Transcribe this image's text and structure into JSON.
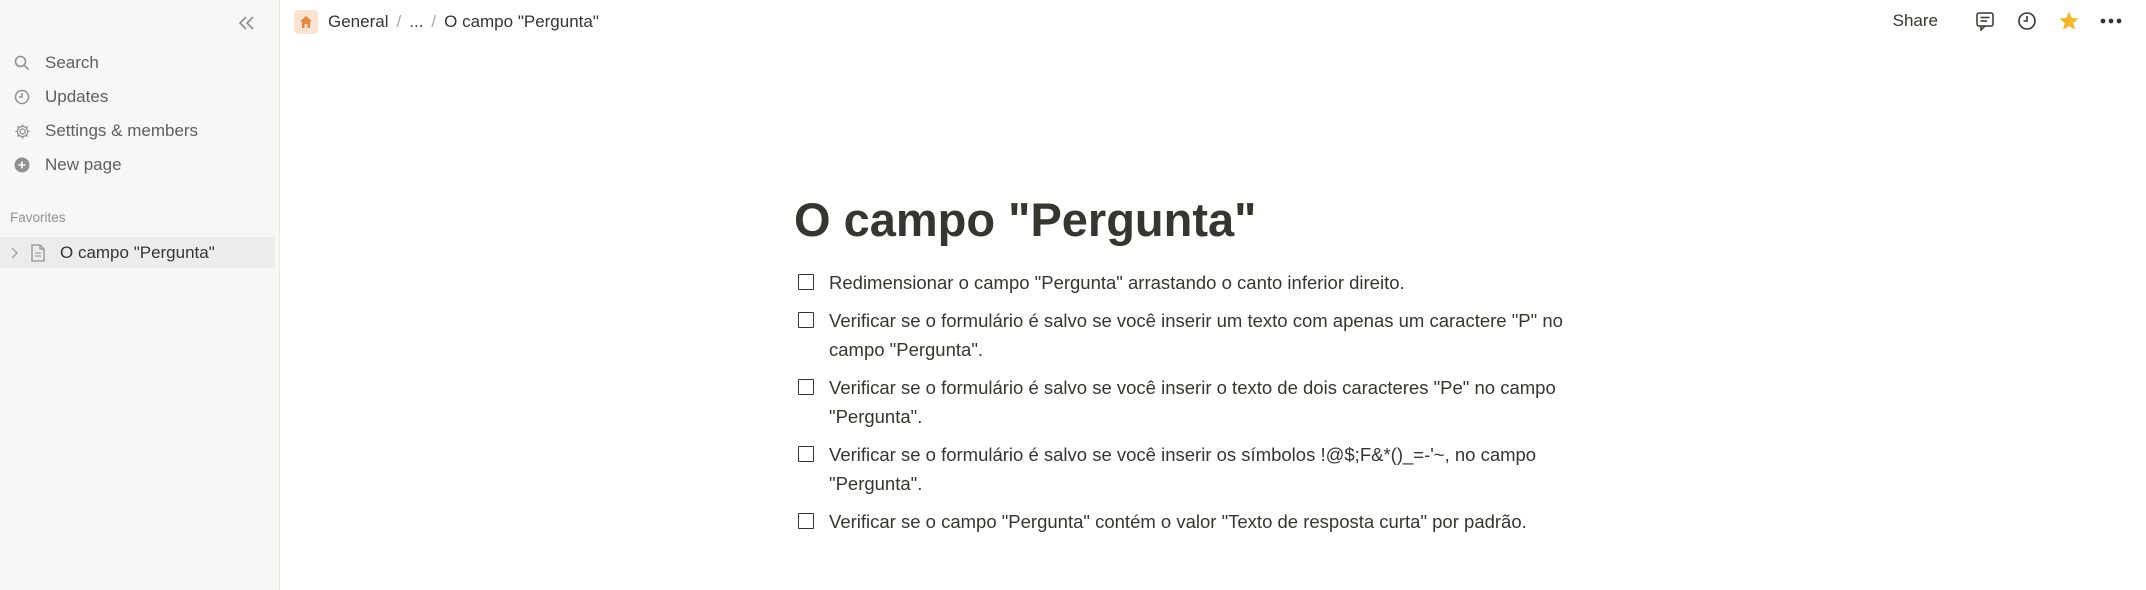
{
  "sidebar": {
    "items": [
      {
        "label": "Search",
        "icon": "search-icon"
      },
      {
        "label": "Updates",
        "icon": "clock-icon"
      },
      {
        "label": "Settings & members",
        "icon": "gear-icon"
      },
      {
        "label": "New page",
        "icon": "plus-circle-icon"
      }
    ],
    "favorites_header": "Favorites",
    "favorites": [
      {
        "label": "O campo \"Pergunta\"",
        "icon": "page-icon"
      }
    ]
  },
  "breadcrumb": {
    "workspace": "General",
    "ellipsis": "...",
    "current": "O campo \"Pergunta\"",
    "separator": "/"
  },
  "topbar": {
    "share_label": "Share"
  },
  "page": {
    "title": "O campo \"Pergunta\"",
    "todos": [
      {
        "text": "Redimensionar o campo \"Pergunta\" arrastando o canto inferior direito.",
        "checked": false
      },
      {
        "text": "Verificar se o formulário é salvo se você inserir um texto com apenas um caractere \"P\" no campo \"Pergunta\".",
        "checked": false
      },
      {
        "text": "Verificar se o formulário é salvo se você inserir o texto de dois caracteres \"Pe\" no campo \"Pergunta\".",
        "checked": false
      },
      {
        "text": "Verificar se o formulário é salvo se você inserir os símbolos !@$;F&*()_=-'~, no campo \"Pergunta\".",
        "checked": false
      },
      {
        "text": "Verificar se o campo \"Pergunta\" contém o valor \"Texto de resposta curta\" por padrão.",
        "checked": false
      }
    ]
  },
  "colors": {
    "accent_home": "#e8843c",
    "star": "#f2b928",
    "sidebar_bg": "#f7f7f5",
    "text": "#37352f"
  }
}
